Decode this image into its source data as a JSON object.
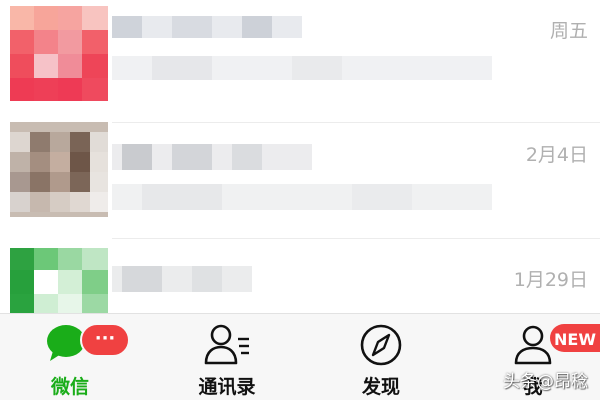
{
  "chats": [
    {
      "time": "周五"
    },
    {
      "time": "2月4日"
    },
    {
      "time": "1月29日"
    }
  ],
  "tabs": [
    {
      "label": "微信",
      "icon": "chat-bubble-icon",
      "badge": "···"
    },
    {
      "label": "通讯录",
      "icon": "contacts-icon"
    },
    {
      "label": "发现",
      "icon": "compass-icon"
    },
    {
      "label": "我",
      "icon": "person-icon",
      "badge": "NEW"
    }
  ],
  "watermark": "头条@昂稔",
  "colors": {
    "accent": "#1aad19",
    "badge": "#f04141"
  }
}
